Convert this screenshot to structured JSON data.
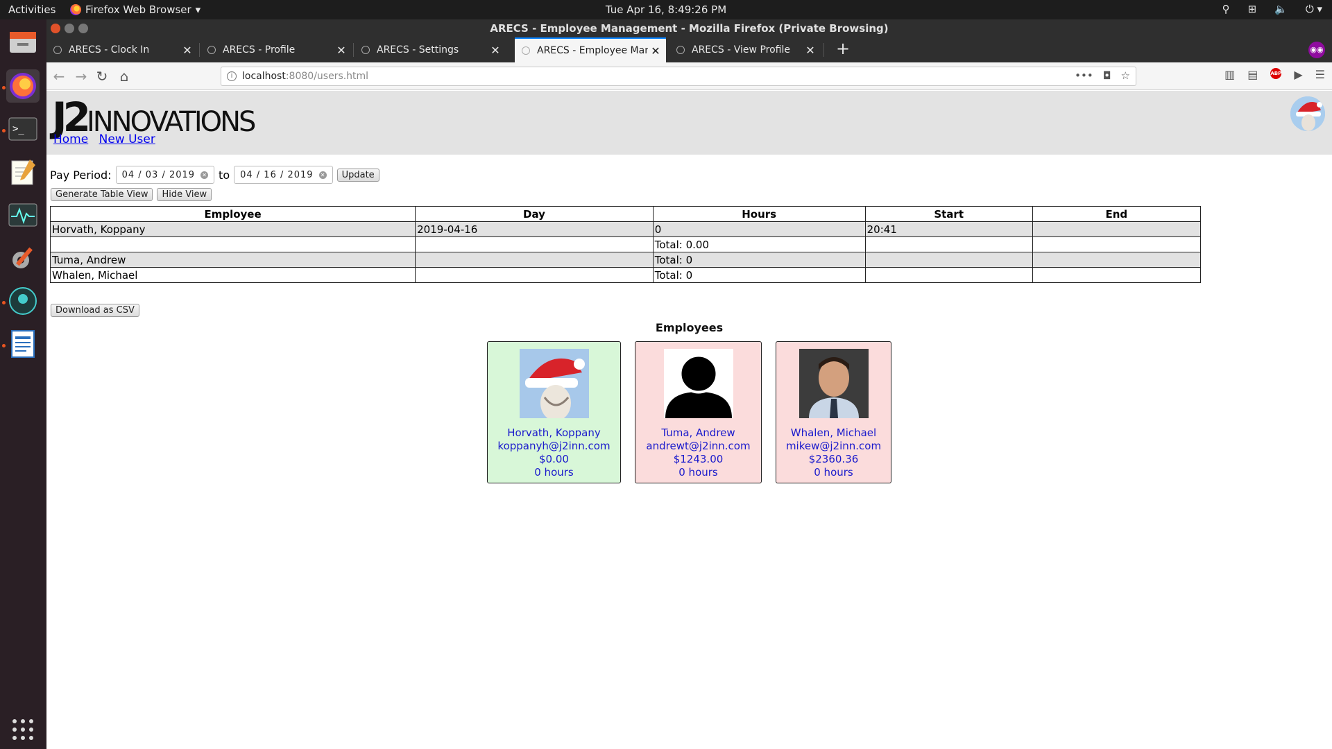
{
  "system": {
    "activities": "Activities",
    "app_menu": "Firefox Web Browser",
    "clock": "Tue Apr 16,  8:49:26 PM"
  },
  "window": {
    "title": "ARECS - Employee Management - Mozilla Firefox (Private Browsing)"
  },
  "tabs": [
    {
      "label": "ARECS - Clock In",
      "active": false
    },
    {
      "label": "ARECS - Profile",
      "active": false
    },
    {
      "label": "ARECS - Settings",
      "active": false
    },
    {
      "label": "ARECS - Employee Mana",
      "active": true
    },
    {
      "label": "ARECS - View Profile",
      "active": false
    }
  ],
  "url": {
    "host": "localhost",
    "rest": ":8080/users.html"
  },
  "header": {
    "logo_big": "J2",
    "logo_small": "INNOVATIONS",
    "nav": [
      "Home",
      "New User"
    ]
  },
  "pay_period": {
    "label": "Pay Period:",
    "start": "04 / 03 / 2019",
    "to": "to",
    "end": "04 / 16 / 2019",
    "update": "Update"
  },
  "view_buttons": {
    "generate": "Generate Table View",
    "hide": "Hide View"
  },
  "table": {
    "headers": [
      "Employee",
      "Day",
      "Hours",
      "Start",
      "End"
    ],
    "rows": [
      [
        "Horvath, Koppany",
        "2019-04-16",
        "0",
        "20:41",
        ""
      ],
      [
        "",
        "",
        "Total: 0.00",
        "",
        ""
      ],
      [
        "Tuma, Andrew",
        "",
        "Total: 0",
        "",
        ""
      ],
      [
        "Whalen, Michael",
        "",
        "Total: 0",
        "",
        ""
      ]
    ]
  },
  "csv_button": "Download as CSV",
  "employees_heading": "Employees",
  "employees": [
    {
      "name": "Horvath, Koppany",
      "email": "koppanyh@j2inn.com",
      "pay": "$0.00",
      "hours": "0 hours",
      "status_color": "#d8f7d8"
    },
    {
      "name": "Tuma, Andrew",
      "email": "andrewt@j2inn.com",
      "pay": "$1243.00",
      "hours": "0 hours",
      "status_color": "#fbdcdc"
    },
    {
      "name": "Whalen, Michael",
      "email": "mikew@j2inn.com",
      "pay": "$2360.36",
      "hours": "0 hours",
      "status_color": "#fbdcdc"
    }
  ]
}
